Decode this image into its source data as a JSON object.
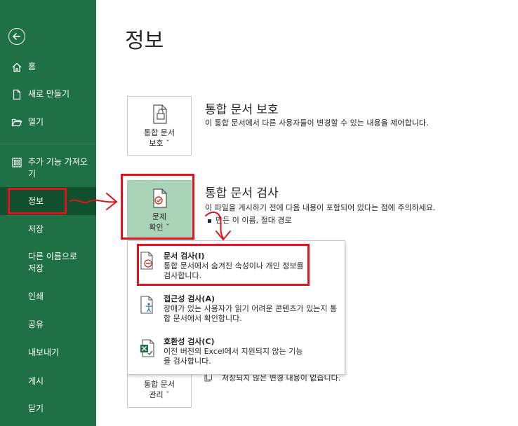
{
  "sidebar": {
    "items": [
      {
        "label": "홈"
      },
      {
        "label": "새로 만들기"
      },
      {
        "label": "열기"
      },
      {
        "label": "추가 기능 가져오기"
      },
      {
        "label": "정보"
      },
      {
        "label": "저장"
      },
      {
        "label": "다른 이름으로 저장"
      },
      {
        "label": "인쇄"
      },
      {
        "label": "공유"
      },
      {
        "label": "내보내기"
      },
      {
        "label": "게시"
      },
      {
        "label": "닫기"
      }
    ],
    "active_item": "정보"
  },
  "page": {
    "title": "정보"
  },
  "protect": {
    "tile_line1": "통합 문서",
    "tile_line2": "보호",
    "title": "통합 문서 보호",
    "desc": "이 통합 문서에서 다른 사용자들이 변경할 수 있는 내용을 제어합니다."
  },
  "inspect": {
    "tile_line1": "문제",
    "tile_line2": "확인",
    "title": "통합 문서 검사",
    "desc": "이 파일을 게시하기 전에 다음 내용이 포함되어 있다는 점에 주의하세요.",
    "bullet": "만든 이 이름, 절대 경로"
  },
  "menu": {
    "items": [
      {
        "title": "문서 검사(I)",
        "desc": "통합 문서에서 숨겨진 속성이나 개인 정보를 검사합니다."
      },
      {
        "title": "접근성 검사(A)",
        "desc": "장애가 있는 사용자가 읽기 어려운 콘텐츠가 있는지 통합 문서에서 확인합니다."
      },
      {
        "title": "호환성 검사(C)",
        "desc": "이전 버전의 Excel에서 지원되지 않는 기능을 검사합니다."
      }
    ]
  },
  "manage": {
    "tile_line1": "통합 문서",
    "tile_line2": "관리",
    "desc": "저장되지 않은 변경 내용이 없습니다."
  },
  "colors": {
    "sidebar": "#1f7145",
    "sidebar_active": "#10502e",
    "highlight": "#e0141e"
  }
}
